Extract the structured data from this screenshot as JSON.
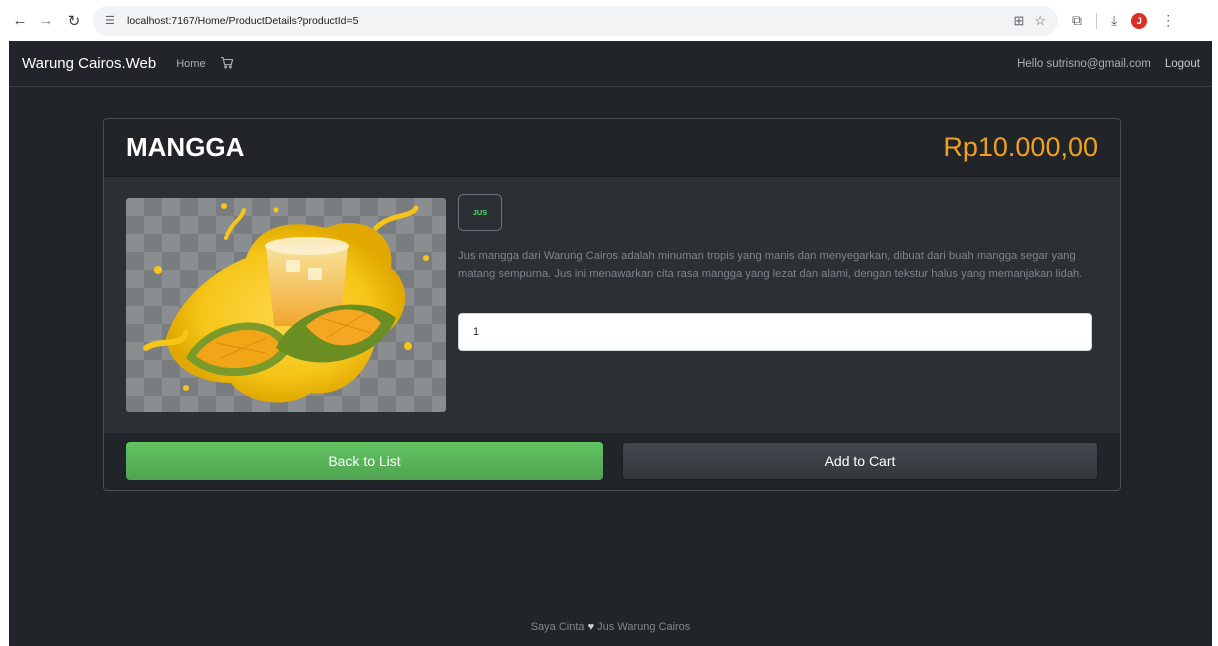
{
  "browser": {
    "url": "localhost:7167/Home/ProductDetails?productId=5",
    "profile_initial": "J"
  },
  "navbar": {
    "brand": "Warung Cairos.Web",
    "home_label": "Home",
    "greeting": "Hello sutrisno@gmail.com",
    "logout_label": "Logout"
  },
  "product": {
    "name": "MANGGA",
    "price": "Rp10.000,00",
    "category": "JUS",
    "description": "Jus mangga dari Warung Cairos adalah minuman tropis yang manis dan menyegarkan, dibuat dari buah mangga segar yang matang sempurna. Jus ini menawarkan cita rasa mangga yang lezat dan alami, dengan tekstur halus yang memanjakan lidah.",
    "quantity": "1"
  },
  "actions": {
    "back_label": "Back to List",
    "add_label": "Add to Cart"
  },
  "footer": {
    "text_before": "Saya Cinta",
    "text_after": "Jus Warung Cairos"
  },
  "colors": {
    "page_bg": "#212529",
    "price": "#f0a020",
    "back_button": "#5cb85c",
    "badge_text": "#4cd964"
  },
  "icons": [
    "arrow-left-icon",
    "arrow-right-icon",
    "reload-icon",
    "site-info-icon",
    "translate-icon",
    "star-icon",
    "extensions-icon",
    "download-icon",
    "menu-dots-icon",
    "cart-icon",
    "heart-icon"
  ]
}
